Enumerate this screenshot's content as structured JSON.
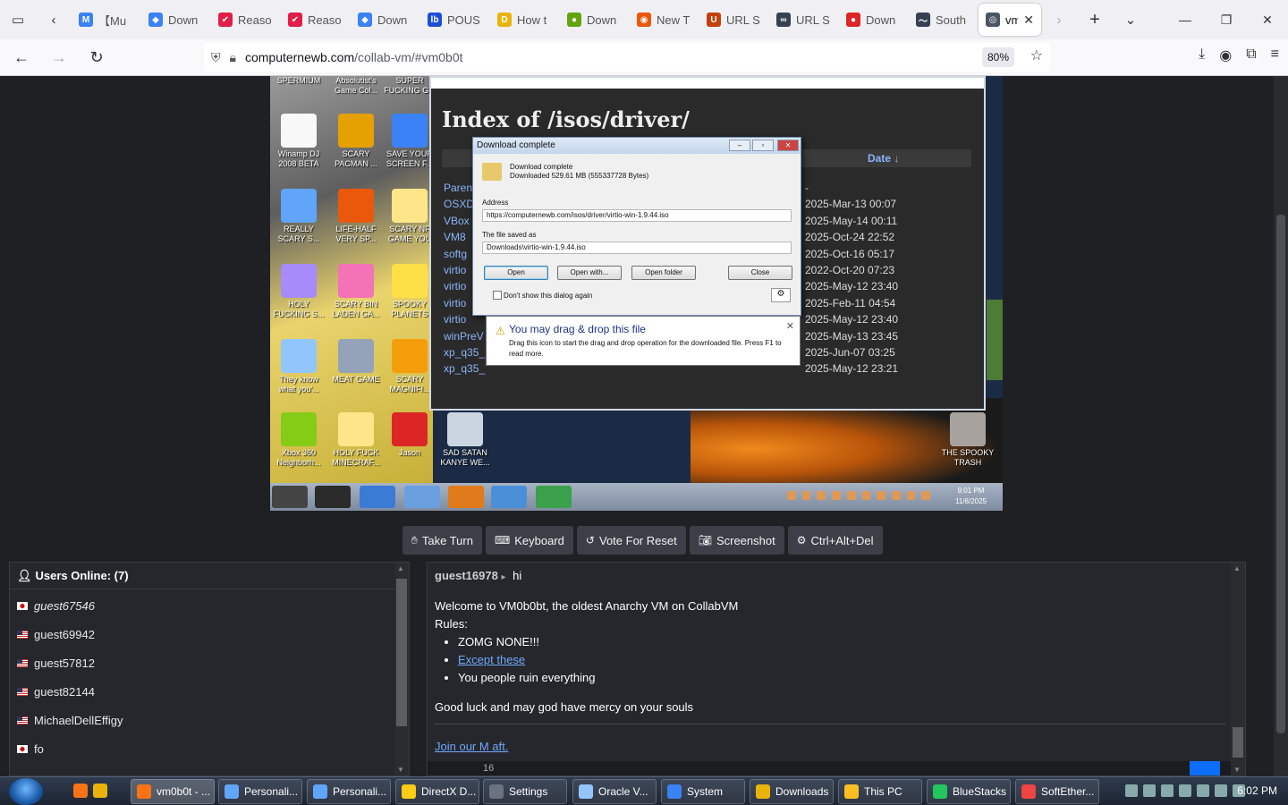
{
  "browser": {
    "tabs": [
      {
        "title": "【Mu",
        "fav_color": "#3b82f6",
        "fav_glyph": "M"
      },
      {
        "title": "Down",
        "fav_color": "#3b82f6",
        "fav_glyph": "◆"
      },
      {
        "title": "Reaso",
        "fav_color": "#e11d48",
        "fav_glyph": "✔"
      },
      {
        "title": "Reaso",
        "fav_color": "#e11d48",
        "fav_glyph": "✔"
      },
      {
        "title": "Down",
        "fav_color": "#3b82f6",
        "fav_glyph": "◆"
      },
      {
        "title": "POUS",
        "fav_color": "#1d4ed8",
        "fav_glyph": "lb"
      },
      {
        "title": "How t",
        "fav_color": "#eab308",
        "fav_glyph": "D"
      },
      {
        "title": "Down",
        "fav_color": "#65a30d",
        "fav_glyph": "●"
      },
      {
        "title": "New T",
        "fav_color": "#ea580c",
        "fav_glyph": "◉"
      },
      {
        "title": "URL S",
        "fav_color": "#c2410c",
        "fav_glyph": "U"
      },
      {
        "title": "URL S",
        "fav_color": "#374151",
        "fav_glyph": "∞"
      },
      {
        "title": "Down",
        "fav_color": "#dc2626",
        "fav_glyph": "●"
      },
      {
        "title": "South",
        "fav_color": "#374151",
        "fav_glyph": "〜"
      }
    ],
    "active_tab": {
      "title": "vm",
      "fav_color": "#4b5563",
      "fav_glyph": "◎"
    },
    "url_host": "computernewb.com",
    "url_rest": "/collab-vm/#vm0b0t",
    "zoom": "80%"
  },
  "vm": {
    "desktop_icons": [
      {
        "label": "SPERMIUM",
        "color": "#666"
      },
      {
        "label": "Absolutist's Game Col...",
        "color": "#777"
      },
      {
        "label": "SUPER FUCKING G...",
        "color": "#888"
      },
      {
        "label": "Winamp DJ 2008 BETA",
        "color": "#f8f8f8"
      },
      {
        "label": "SCARY PACMAN ...",
        "color": "#e5a100"
      },
      {
        "label": "SAVE YOUR SCREEN F...",
        "color": "#3b82f6"
      },
      {
        "label": "REALLY SCARY S...",
        "color": "#60a5fa"
      },
      {
        "label": "LIFE-HALF VERY SP...",
        "color": "#ea580c"
      },
      {
        "label": "SCARY NF GAME YOU",
        "color": "#fde68a"
      },
      {
        "label": "HOLY FUCKING S...",
        "color": "#a78bfa"
      },
      {
        "label": "SCARY BIN LADEN GA...",
        "color": "#f472b6"
      },
      {
        "label": "SPOOKY PLANETS",
        "color": "#fde047"
      },
      {
        "label": "They know what you'...",
        "color": "#93c5fd"
      },
      {
        "label": "MEAT GAME",
        "color": "#94a3b8"
      },
      {
        "label": "SCARY MAGNIFI...",
        "color": "#f59e0b"
      },
      {
        "label": "Xbox 360 Neighborh...",
        "color": "#84cc16"
      },
      {
        "label": "HOLY FUCK MINECRAF...",
        "color": "#fde68a"
      },
      {
        "label": "Jason",
        "color": "#dc2626"
      },
      {
        "label": "SAD SATAN KANYE WE...",
        "color": "#cbd5e1"
      },
      {
        "label": "THE SPOOKY TRASH",
        "color": "#a8a29e"
      }
    ],
    "index_title": "Index of /isos/driver/",
    "date_header": "Date ↓",
    "file_rows": [
      {
        "name": "Paren",
        "date": "-"
      },
      {
        "name": "OSXD",
        "date": "2025-Mar-13 00:07"
      },
      {
        "name": "VBox",
        "date": "2025-May-14 00:11"
      },
      {
        "name": "VM8",
        "date": "2025-Oct-24 22:52"
      },
      {
        "name": "softg",
        "date": "2025-Oct-16 05:17"
      },
      {
        "name": "virtio",
        "date": "2022-Oct-20 07:23"
      },
      {
        "name": "virtio",
        "date": "2025-May-12 23:40"
      },
      {
        "name": "virtio",
        "date": "2025-Feb-11 04:54"
      },
      {
        "name": "virtio",
        "date": "2025-May-12 23:40"
      },
      {
        "name": "winPreV",
        "date": "2025-May-13 23:45"
      },
      {
        "name": "xp_q35_",
        "date": "2025-Jun-07 03:25"
      },
      {
        "name": "xp_q35_",
        "date": "2025-May-12 23:21"
      }
    ],
    "download_dialog": {
      "title": "Download complete",
      "heading": "Download complete",
      "size_text": "Downloaded 529.61 MB (555337728 Bytes)",
      "address_label": "Address",
      "address_value": "https://computernewb.com/isos/driver/virtio-win-1.9.44.iso",
      "saved_label": "The file saved as",
      "saved_value": "Downloads\\virtio-win-1.9.44.iso",
      "btn_open": "Open",
      "btn_open_with": "Open with...",
      "btn_open_folder": "Open folder",
      "btn_close": "Close",
      "checkbox_label": "Don't show this dialog again"
    },
    "tooltip": {
      "title": "You may drag & drop this file",
      "body": "Drag this icon to start the drag and drop operation for the downloaded file. Press F1 to read more."
    },
    "clock_time": "9:01 PM",
    "clock_date": "11/8/2025"
  },
  "toolbar": {
    "take_turn": "Take Turn",
    "keyboard": "Keyboard",
    "vote_reset": "Vote For Reset",
    "screenshot": "Screenshot",
    "ctrl_alt_del": "Ctrl+Alt+Del"
  },
  "users": {
    "header": "Users Online: (7)",
    "list": [
      {
        "name": "guest67546",
        "flag": "jp",
        "italic": true
      },
      {
        "name": "guest69942",
        "flag": "us",
        "italic": false
      },
      {
        "name": "guest57812",
        "flag": "us",
        "italic": false
      },
      {
        "name": "guest82144",
        "flag": "us",
        "italic": false
      },
      {
        "name": "MichaelDellEffigy",
        "flag": "us",
        "italic": false
      },
      {
        "name": "fo",
        "flag": "jp",
        "italic": false
      }
    ]
  },
  "chat": {
    "sender": "guest16978",
    "arrow": "▸",
    "message": "hi",
    "welcome": "Welcome to VM0b0bt, the oldest Anarchy VM on CollabVM",
    "rules_label": "Rules:",
    "rules": [
      "ZOMG NONE!!!",
      "Except these",
      "You people ruin everything"
    ],
    "goodbye": "Good luck and may god have mercy on your souls",
    "join_link": "Join our M    aft.",
    "char_count": "16"
  },
  "taskbar": {
    "tasks": [
      {
        "label": "vm0b0t - ...",
        "color": "#f97316",
        "active": true
      },
      {
        "label": "Personali...",
        "color": "#60a5fa",
        "active": false
      },
      {
        "label": "Personali...",
        "color": "#60a5fa",
        "active": false
      },
      {
        "label": "DirectX D...",
        "color": "#facc15",
        "active": false
      },
      {
        "label": "Settings",
        "color": "#6b7280",
        "active": false
      },
      {
        "label": "Oracle V...",
        "color": "#93c5fd",
        "active": false
      },
      {
        "label": "System",
        "color": "#3b82f6",
        "active": false
      },
      {
        "label": "Downloads",
        "color": "#eab308",
        "active": false
      },
      {
        "label": "This PC",
        "color": "#fbbf24",
        "active": false
      },
      {
        "label": "BlueStacks",
        "color": "#22c55e",
        "active": false
      },
      {
        "label": "SoftEther...",
        "color": "#ef4444",
        "active": false
      }
    ],
    "clock": "6:02 PM"
  }
}
